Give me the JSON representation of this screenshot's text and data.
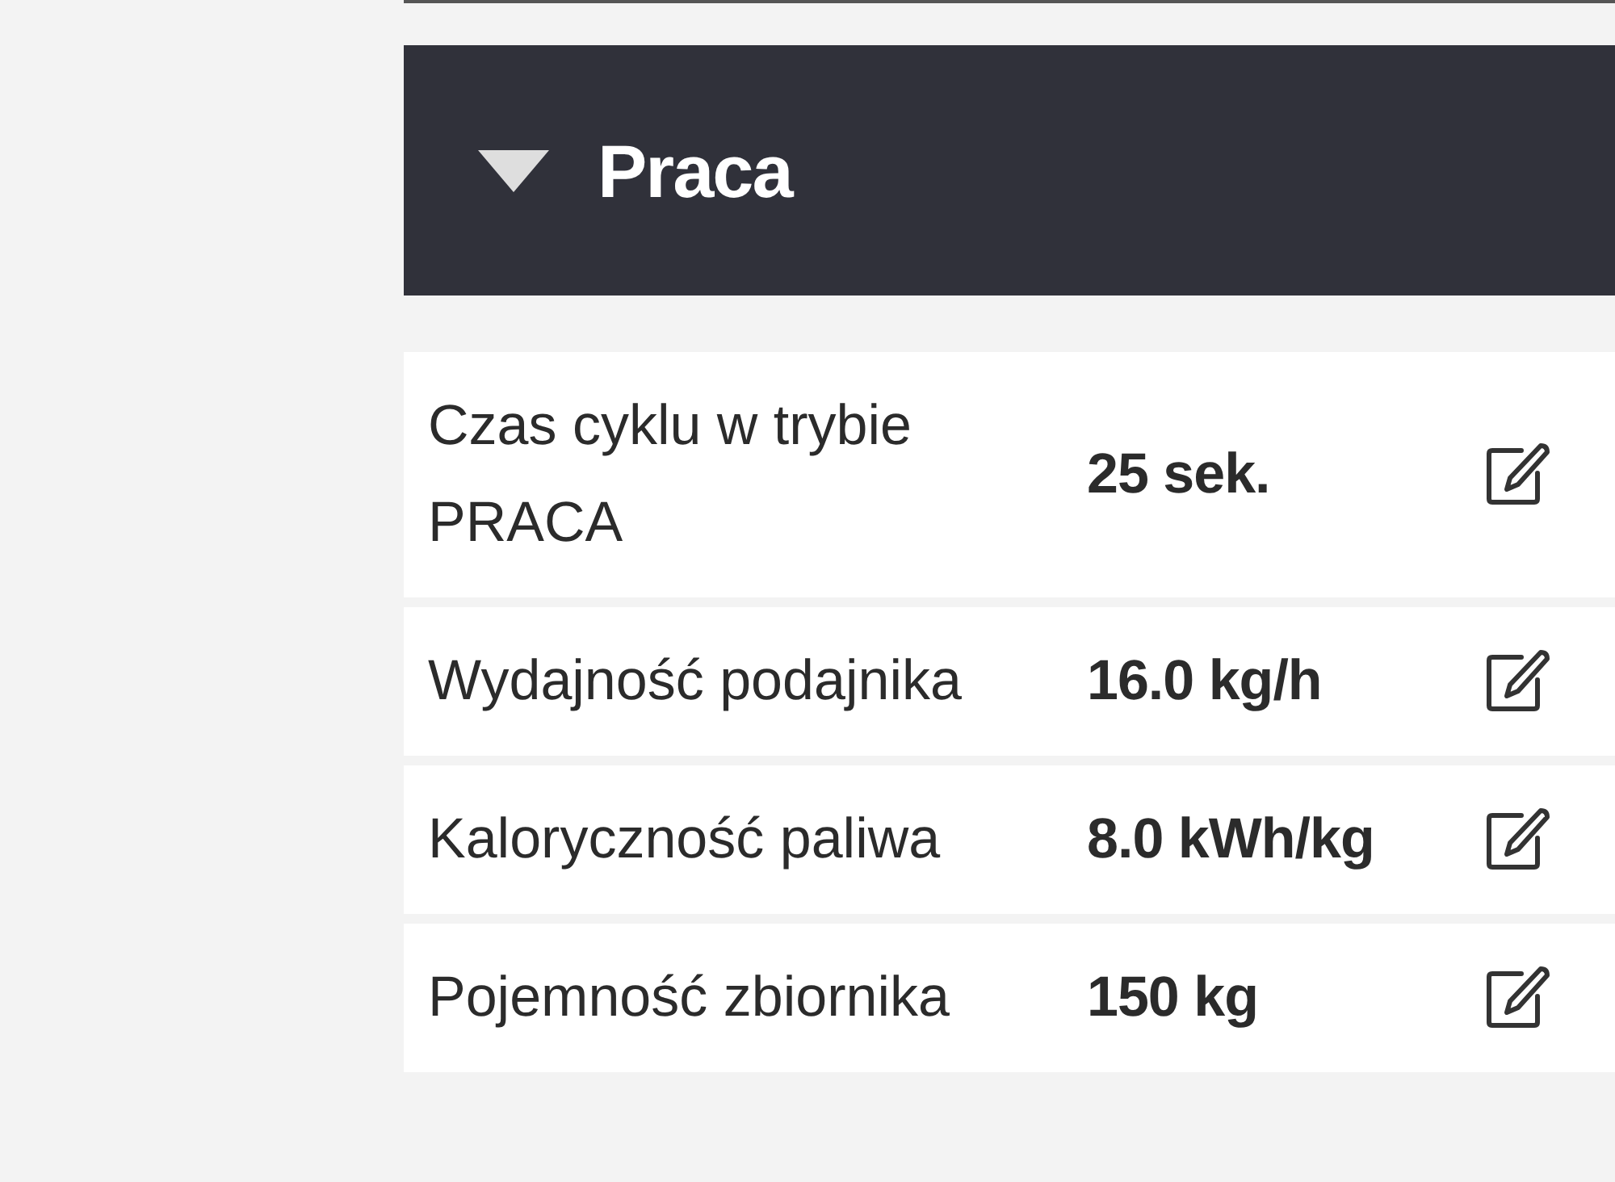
{
  "section": {
    "title": "Praca",
    "expanded": true
  },
  "rows": [
    {
      "label": "Czas cyklu w trybie PRACA",
      "value": "25 sek."
    },
    {
      "label": "Wydajność podajnika",
      "value": "16.0 kg/h"
    },
    {
      "label": "Kaloryczność paliwa",
      "value": "8.0 kWh/kg"
    },
    {
      "label": "Pojemność zbiornika",
      "value": "150 kg"
    }
  ]
}
